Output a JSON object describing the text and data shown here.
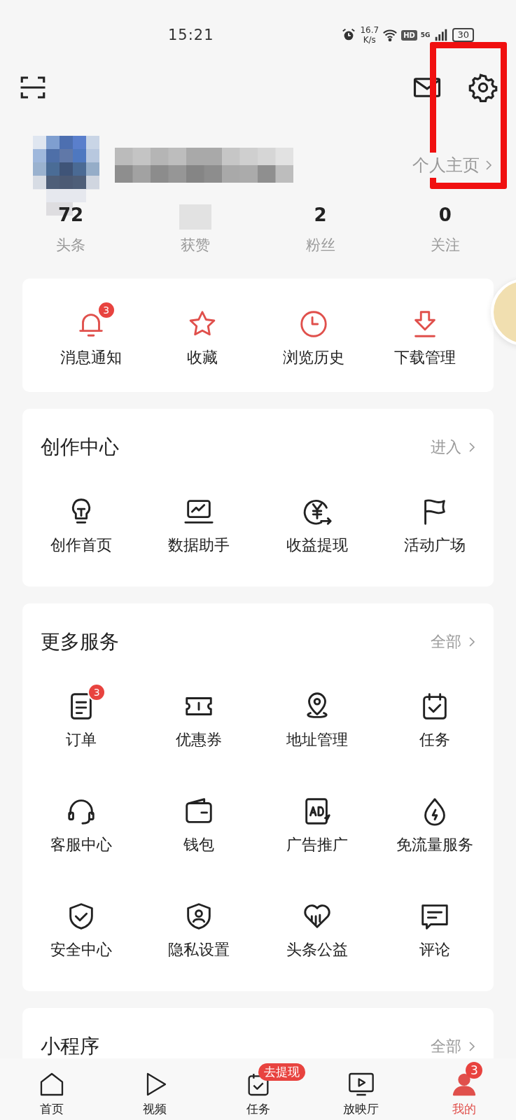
{
  "status_bar": {
    "time": "15:21",
    "speed": "16.7",
    "speed_unit": "K/s",
    "hd": "HD",
    "network": "5G",
    "battery": "30"
  },
  "profile": {
    "link": "个人主页"
  },
  "stats": [
    {
      "value": "72",
      "label": "头条"
    },
    {
      "label": "获赞"
    },
    {
      "value": "2",
      "label": "粉丝"
    },
    {
      "value": "0",
      "label": "关注"
    }
  ],
  "quick_actions": [
    {
      "label": "消息通知",
      "badge": "3"
    },
    {
      "label": "收藏"
    },
    {
      "label": "浏览历史"
    },
    {
      "label": "下载管理"
    }
  ],
  "sections": [
    {
      "title": "创作中心",
      "link": "进入",
      "items": [
        {
          "label": "创作首页"
        },
        {
          "label": "数据助手"
        },
        {
          "label": "收益提现"
        },
        {
          "label": "活动广场"
        }
      ]
    },
    {
      "title": "更多服务",
      "link": "全部",
      "items": [
        {
          "label": "订单",
          "badge": "3"
        },
        {
          "label": "优惠券"
        },
        {
          "label": "地址管理"
        },
        {
          "label": "任务"
        },
        {
          "label": "客服中心"
        },
        {
          "label": "钱包"
        },
        {
          "label": "广告推广"
        },
        {
          "label": "免流量服务"
        },
        {
          "label": "安全中心"
        },
        {
          "label": "隐私设置"
        },
        {
          "label": "头条公益"
        },
        {
          "label": "评论"
        }
      ]
    },
    {
      "title": "小程序",
      "link": "全部"
    }
  ],
  "bottom_nav": [
    {
      "label": "首页",
      "selected": false
    },
    {
      "label": "视频",
      "selected": false
    },
    {
      "label": "任务",
      "selected": false,
      "badge": "去提现"
    },
    {
      "label": "放映厅",
      "selected": false
    },
    {
      "label": "我的",
      "selected": true,
      "badge": "3"
    }
  ],
  "annotation": {
    "kind": "frame"
  }
}
